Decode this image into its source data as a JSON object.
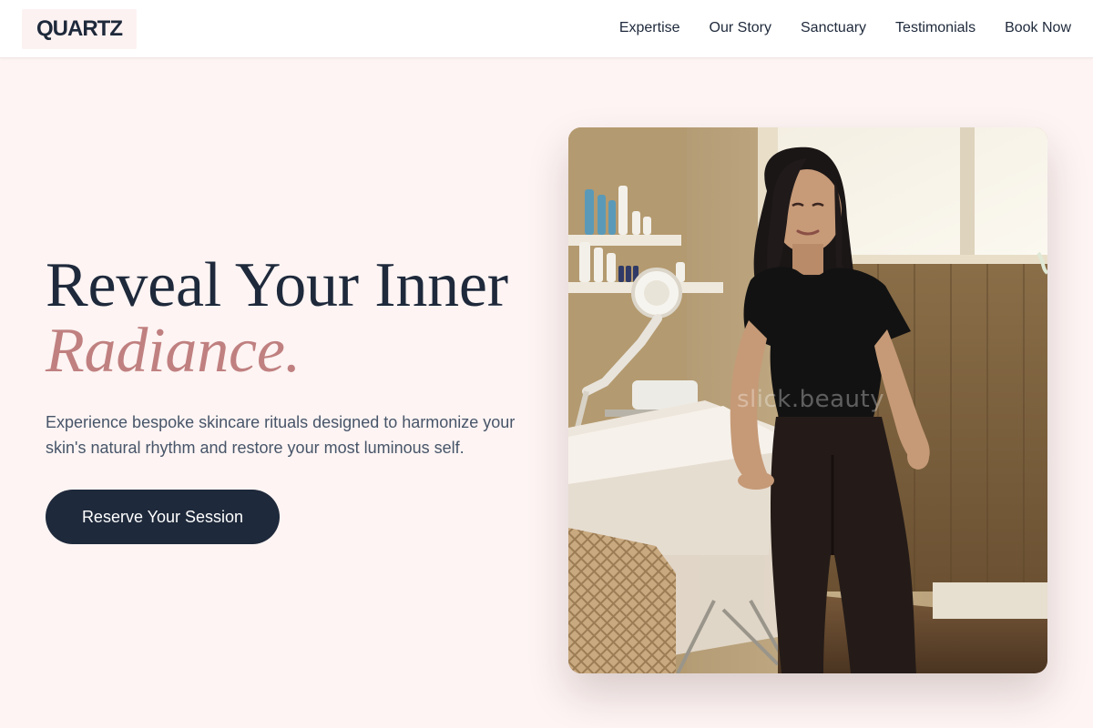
{
  "brand": {
    "logo": "QUARTZ"
  },
  "nav": {
    "items": [
      {
        "label": "Expertise"
      },
      {
        "label": "Our Story"
      },
      {
        "label": "Sanctuary"
      },
      {
        "label": "Testimonials"
      },
      {
        "label": "Book Now"
      }
    ]
  },
  "hero": {
    "headline_line1": "Reveal Your Inner",
    "headline_accent": "Radiance.",
    "description": "Experience bespoke skincare rituals designed to harmonize your skin's natural rhythm and restore your most luminous self.",
    "cta_label": "Reserve Your Session",
    "image_watermark": "slick.beauty"
  },
  "colors": {
    "page_background": "#fdf4f3",
    "header_background": "#ffffff",
    "primary_dark": "#1e293b",
    "accent_rose": "#c08080",
    "body_text": "#475569"
  }
}
